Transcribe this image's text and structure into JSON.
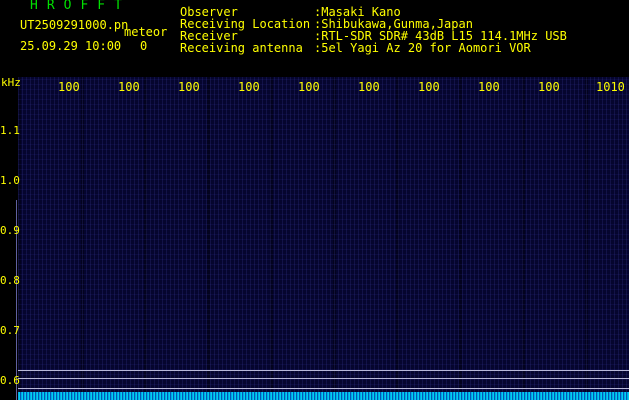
{
  "app": {
    "title": "HROFFT"
  },
  "capture": {
    "filename": "UT2509291000.pn",
    "tag": "meteor",
    "datetime": "25.09.29 10:00",
    "count": "0"
  },
  "info": [
    {
      "label": "Observer",
      "value": ":Masaki Kano"
    },
    {
      "label": "Receiving Location",
      "value": ":Shibukawa,Gunma,Japan"
    },
    {
      "label": "Receiver",
      "value": ":RTL-SDR SDR# 43dB L15 114.1MHz USB"
    },
    {
      "label": "Receiving antenna",
      "value": ":5el Yagi Az 20 for Aomori VOR"
    }
  ],
  "freq_axis": {
    "unit": "kHz",
    "tick_labels": [
      "1.1",
      "1.0",
      "0.9",
      "0.8",
      "0.7",
      "0.6"
    ]
  },
  "time_axis": {
    "tick_labels": [
      "100",
      "100",
      "100",
      "100",
      "100",
      "100",
      "100",
      "100",
      "100",
      "1010"
    ]
  },
  "colors": {
    "text": "#ffff00",
    "title": "#00e000",
    "spectrogram_bg": "#05052e",
    "noise_trace": "#00e8ff"
  }
}
